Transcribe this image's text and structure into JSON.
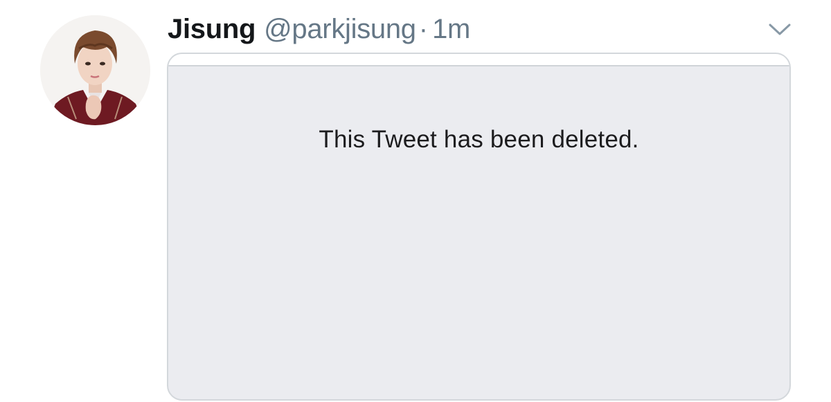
{
  "tweet": {
    "display_name": "Jisung",
    "handle": "@parkjisung",
    "separator": "·",
    "timestamp": "1m",
    "menu_icon": "chevron-down-icon",
    "avatar_icon": "avatar"
  },
  "quoted_tweet": {
    "status_text": "This Tweet has been deleted."
  },
  "colors": {
    "name": "#14171a",
    "secondary": "#657786",
    "card_background": "#ebecf0",
    "card_border": "#d3d7db"
  }
}
